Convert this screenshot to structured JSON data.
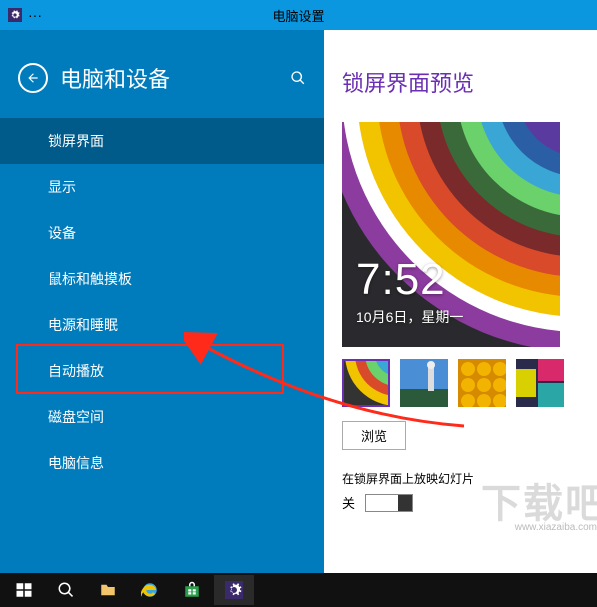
{
  "titlebar": {
    "center": "电脑设置"
  },
  "sidebar": {
    "title": "电脑和设备",
    "items": [
      {
        "label": "锁屏界面",
        "selected": true
      },
      {
        "label": "显示",
        "selected": false
      },
      {
        "label": "设备",
        "selected": false
      },
      {
        "label": "鼠标和触摸板",
        "selected": false
      },
      {
        "label": "电源和睡眠",
        "selected": false
      },
      {
        "label": "自动播放",
        "selected": false
      },
      {
        "label": "磁盘空间",
        "selected": false
      },
      {
        "label": "电脑信息",
        "selected": false
      }
    ],
    "highlighted_index": 5
  },
  "content": {
    "title": "锁屏界面预览",
    "preview": {
      "time": "7:52",
      "date": "10月6日，星期一"
    },
    "browse_label": "浏览",
    "slideshow": {
      "label": "在锁屏界面上放映幻灯片",
      "state_label": "关",
      "on": false
    }
  },
  "watermark": {
    "text": "下载吧",
    "url": "www.xiazaiba.com"
  },
  "icons": {
    "gear": "gear-icon",
    "back": "back-arrow-icon",
    "search": "search-icon",
    "start": "windows-start-icon",
    "explorer": "folder-icon",
    "ie": "ie-icon",
    "store": "store-icon",
    "settings": "settings-icon",
    "search_tb": "search-taskbar-icon"
  },
  "colors": {
    "sidebar_bg": "#007cbd",
    "sidebar_sel": "#005a8a",
    "accent": "#6b2fb3",
    "highlight": "#ff2a1a"
  }
}
